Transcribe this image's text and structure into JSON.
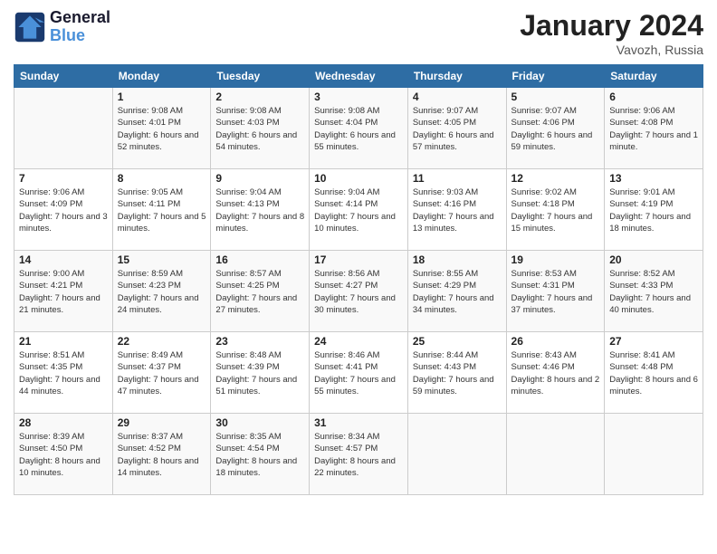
{
  "header": {
    "logo_line1": "General",
    "logo_line2": "Blue",
    "month": "January 2024",
    "location": "Vavozh, Russia"
  },
  "weekdays": [
    "Sunday",
    "Monday",
    "Tuesday",
    "Wednesday",
    "Thursday",
    "Friday",
    "Saturday"
  ],
  "weeks": [
    [
      {
        "day": "",
        "info": ""
      },
      {
        "day": "1",
        "info": "Sunrise: 9:08 AM\nSunset: 4:01 PM\nDaylight: 6 hours\nand 52 minutes."
      },
      {
        "day": "2",
        "info": "Sunrise: 9:08 AM\nSunset: 4:03 PM\nDaylight: 6 hours\nand 54 minutes."
      },
      {
        "day": "3",
        "info": "Sunrise: 9:08 AM\nSunset: 4:04 PM\nDaylight: 6 hours\nand 55 minutes."
      },
      {
        "day": "4",
        "info": "Sunrise: 9:07 AM\nSunset: 4:05 PM\nDaylight: 6 hours\nand 57 minutes."
      },
      {
        "day": "5",
        "info": "Sunrise: 9:07 AM\nSunset: 4:06 PM\nDaylight: 6 hours\nand 59 minutes."
      },
      {
        "day": "6",
        "info": "Sunrise: 9:06 AM\nSunset: 4:08 PM\nDaylight: 7 hours\nand 1 minute."
      }
    ],
    [
      {
        "day": "7",
        "info": "Sunrise: 9:06 AM\nSunset: 4:09 PM\nDaylight: 7 hours\nand 3 minutes."
      },
      {
        "day": "8",
        "info": "Sunrise: 9:05 AM\nSunset: 4:11 PM\nDaylight: 7 hours\nand 5 minutes."
      },
      {
        "day": "9",
        "info": "Sunrise: 9:04 AM\nSunset: 4:13 PM\nDaylight: 7 hours\nand 8 minutes."
      },
      {
        "day": "10",
        "info": "Sunrise: 9:04 AM\nSunset: 4:14 PM\nDaylight: 7 hours\nand 10 minutes."
      },
      {
        "day": "11",
        "info": "Sunrise: 9:03 AM\nSunset: 4:16 PM\nDaylight: 7 hours\nand 13 minutes."
      },
      {
        "day": "12",
        "info": "Sunrise: 9:02 AM\nSunset: 4:18 PM\nDaylight: 7 hours\nand 15 minutes."
      },
      {
        "day": "13",
        "info": "Sunrise: 9:01 AM\nSunset: 4:19 PM\nDaylight: 7 hours\nand 18 minutes."
      }
    ],
    [
      {
        "day": "14",
        "info": "Sunrise: 9:00 AM\nSunset: 4:21 PM\nDaylight: 7 hours\nand 21 minutes."
      },
      {
        "day": "15",
        "info": "Sunrise: 8:59 AM\nSunset: 4:23 PM\nDaylight: 7 hours\nand 24 minutes."
      },
      {
        "day": "16",
        "info": "Sunrise: 8:57 AM\nSunset: 4:25 PM\nDaylight: 7 hours\nand 27 minutes."
      },
      {
        "day": "17",
        "info": "Sunrise: 8:56 AM\nSunset: 4:27 PM\nDaylight: 7 hours\nand 30 minutes."
      },
      {
        "day": "18",
        "info": "Sunrise: 8:55 AM\nSunset: 4:29 PM\nDaylight: 7 hours\nand 34 minutes."
      },
      {
        "day": "19",
        "info": "Sunrise: 8:53 AM\nSunset: 4:31 PM\nDaylight: 7 hours\nand 37 minutes."
      },
      {
        "day": "20",
        "info": "Sunrise: 8:52 AM\nSunset: 4:33 PM\nDaylight: 7 hours\nand 40 minutes."
      }
    ],
    [
      {
        "day": "21",
        "info": "Sunrise: 8:51 AM\nSunset: 4:35 PM\nDaylight: 7 hours\nand 44 minutes."
      },
      {
        "day": "22",
        "info": "Sunrise: 8:49 AM\nSunset: 4:37 PM\nDaylight: 7 hours\nand 47 minutes."
      },
      {
        "day": "23",
        "info": "Sunrise: 8:48 AM\nSunset: 4:39 PM\nDaylight: 7 hours\nand 51 minutes."
      },
      {
        "day": "24",
        "info": "Sunrise: 8:46 AM\nSunset: 4:41 PM\nDaylight: 7 hours\nand 55 minutes."
      },
      {
        "day": "25",
        "info": "Sunrise: 8:44 AM\nSunset: 4:43 PM\nDaylight: 7 hours\nand 59 minutes."
      },
      {
        "day": "26",
        "info": "Sunrise: 8:43 AM\nSunset: 4:46 PM\nDaylight: 8 hours\nand 2 minutes."
      },
      {
        "day": "27",
        "info": "Sunrise: 8:41 AM\nSunset: 4:48 PM\nDaylight: 8 hours\nand 6 minutes."
      }
    ],
    [
      {
        "day": "28",
        "info": "Sunrise: 8:39 AM\nSunset: 4:50 PM\nDaylight: 8 hours\nand 10 minutes."
      },
      {
        "day": "29",
        "info": "Sunrise: 8:37 AM\nSunset: 4:52 PM\nDaylight: 8 hours\nand 14 minutes."
      },
      {
        "day": "30",
        "info": "Sunrise: 8:35 AM\nSunset: 4:54 PM\nDaylight: 8 hours\nand 18 minutes."
      },
      {
        "day": "31",
        "info": "Sunrise: 8:34 AM\nSunset: 4:57 PM\nDaylight: 8 hours\nand 22 minutes."
      },
      {
        "day": "",
        "info": ""
      },
      {
        "day": "",
        "info": ""
      },
      {
        "day": "",
        "info": ""
      }
    ]
  ]
}
